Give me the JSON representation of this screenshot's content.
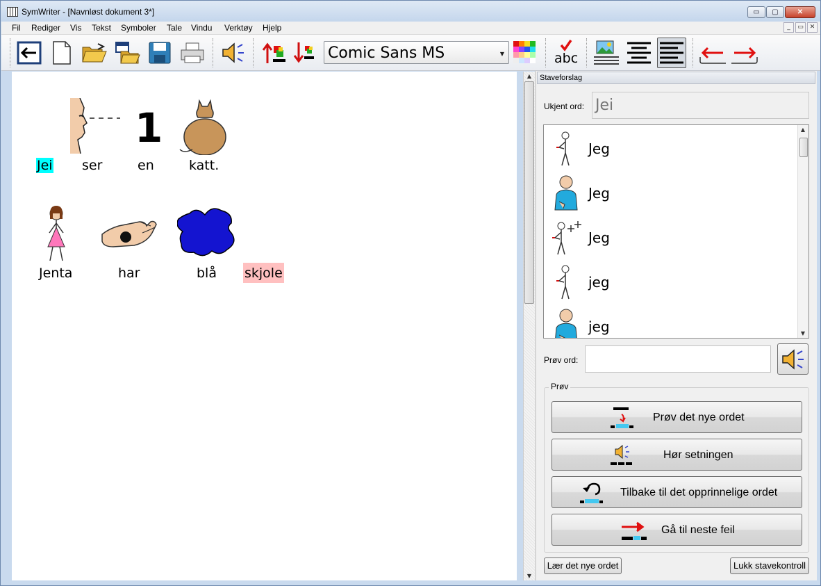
{
  "window": {
    "title": "SymWriter - [Navnløst dokument 3*]",
    "min": "▭",
    "max": "▢",
    "close": "✕"
  },
  "mdi": {
    "min": "_",
    "restore": "▭",
    "close": "✕"
  },
  "menu": [
    "Fil",
    "Rediger",
    "Vis",
    "Tekst",
    "Symboler",
    "Tale",
    "Vindu",
    "Verktøy",
    "Hjelp"
  ],
  "toolbar": {
    "font": "Comic Sans MS",
    "spell_label": "abc",
    "icons": [
      "back-icon",
      "new-document-icon",
      "open-folder-icon",
      "open-recent-icon",
      "save-icon",
      "print-icon",
      "speaker-icon",
      "symbol-up-icon",
      "symbol-down-icon",
      "color-palette-icon",
      "spell-check-icon",
      "picture-layout-icon",
      "align-center-icon",
      "align-left-icon",
      "undo-arrow-icon",
      "redo-arrow-icon"
    ]
  },
  "document": {
    "line1": [
      "Jei",
      "ser",
      "en",
      "katt."
    ],
    "line2": [
      "Jenta",
      "har",
      "blå",
      "skjole"
    ],
    "digit": "1"
  },
  "panel": {
    "title": "Staveforslag",
    "unknown_label": "Ukjent ord:",
    "unknown_value": "Jei",
    "suggestions": [
      "Jeg",
      "Jeg",
      "Jeg",
      "jeg",
      "jeg"
    ],
    "try_label": "Prøv ord:",
    "try_value": "",
    "group_label": "Prøv",
    "btn_try": "Prøv det nye ordet",
    "btn_hear": "Hør setningen",
    "btn_back": "Tilbake til det opprinnelige ordet",
    "btn_next": "Gå til neste feil",
    "btn_learn": "Lær det nye ordet",
    "btn_close": "Lukk stavekontroll"
  },
  "colors": {
    "highlight_unknown": "#00ffff",
    "highlight_error": "#ffc0c0",
    "accent_blue": "#1e6fd0",
    "arrow_red": "#e01010"
  }
}
